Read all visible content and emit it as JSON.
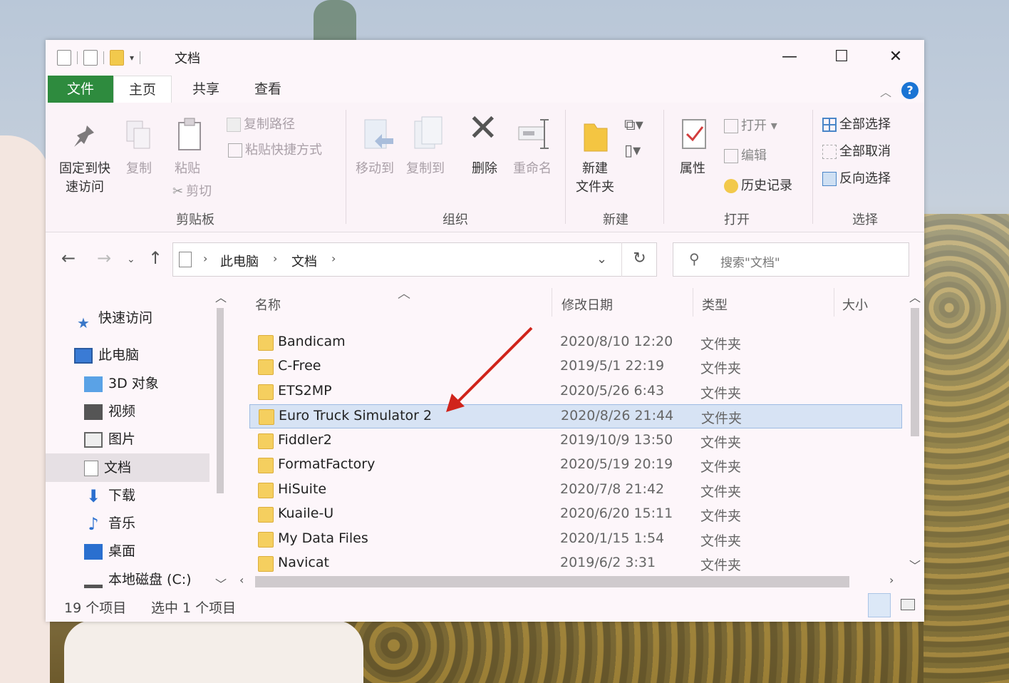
{
  "window": {
    "title": "文档",
    "controls": {
      "minimize": "—",
      "maximize": "☐",
      "close": "✕"
    }
  },
  "ribbon_tabs": [
    "文件",
    "主页",
    "共享",
    "查看"
  ],
  "ribbon": {
    "clipboard": {
      "pin": "固定到快\n速访问",
      "copy": "复制",
      "paste": "粘贴",
      "copy_path": "复制路径",
      "paste_shortcut": "粘贴快捷方式",
      "cut": "剪切",
      "group": "剪贴板"
    },
    "organize": {
      "move_to": "移动到",
      "copy_to": "复制到",
      "delete": "删除",
      "rename": "重命名",
      "group": "组织"
    },
    "new": {
      "new_folder": "新建\n文件夹",
      "group": "新建"
    },
    "open": {
      "properties": "属性",
      "open": "打开",
      "edit": "编辑",
      "history": "历史记录",
      "group": "打开"
    },
    "select": {
      "select_all": "全部选择",
      "select_none": "全部取消",
      "invert": "反向选择",
      "group": "选择"
    }
  },
  "address": {
    "crumbs": [
      "此电脑",
      "文档"
    ],
    "search_placeholder": "搜索\"文档\""
  },
  "nav": {
    "quick_access": "快速访问",
    "this_pc": "此电脑",
    "items": [
      "3D 对象",
      "视频",
      "图片",
      "文档",
      "下载",
      "音乐",
      "桌面",
      "本地磁盘 (C:)"
    ]
  },
  "columns": [
    "名称",
    "修改日期",
    "类型",
    "大小"
  ],
  "files": [
    {
      "name": "Bandicam",
      "date": "2020/8/10 12:20",
      "type": "文件夹"
    },
    {
      "name": "C-Free",
      "date": "2019/5/1 22:19",
      "type": "文件夹"
    },
    {
      "name": "ETS2MP",
      "date": "2020/5/26 6:43",
      "type": "文件夹"
    },
    {
      "name": "Euro Truck Simulator 2",
      "date": "2020/8/26 21:44",
      "type": "文件夹"
    },
    {
      "name": "Fiddler2",
      "date": "2019/10/9 13:50",
      "type": "文件夹"
    },
    {
      "name": "FormatFactory",
      "date": "2020/5/19 20:19",
      "type": "文件夹"
    },
    {
      "name": "HiSuite",
      "date": "2020/7/8 21:42",
      "type": "文件夹"
    },
    {
      "name": "Kuaile-U",
      "date": "2020/6/20 15:11",
      "type": "文件夹"
    },
    {
      "name": "My Data Files",
      "date": "2020/1/15 1:54",
      "type": "文件夹"
    },
    {
      "name": "Navicat",
      "date": "2019/6/2 3:31",
      "type": "文件夹"
    }
  ],
  "selected_file_index": 3,
  "status": {
    "count": "19 个项目",
    "selected": "选中 1 个项目"
  },
  "colors": {
    "file_tab": "#2e8b3e",
    "selection": "#d7e3f4",
    "annotation_arrow": "#d0241b",
    "help": "#1a74d4"
  }
}
